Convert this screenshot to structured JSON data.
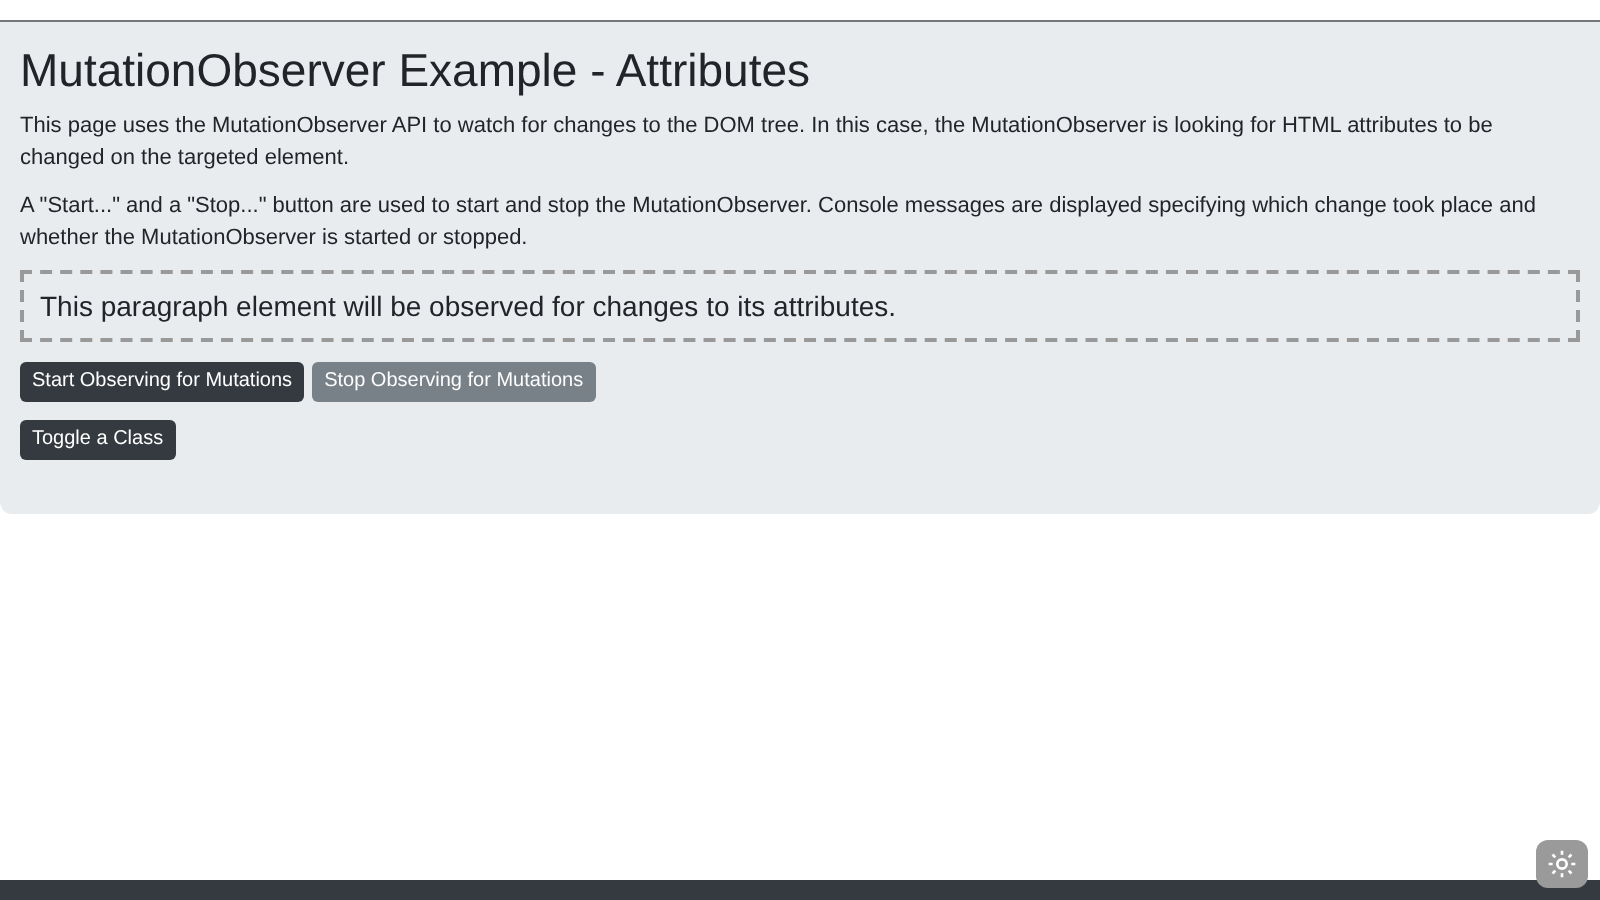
{
  "title": "MutationObserver Example - Attributes",
  "paragraphs": [
    "This page uses the MutationObserver API to watch for changes to the DOM tree. In this case, the MutationObserver is looking for HTML attributes to be changed on the targeted element.",
    "A \"Start...\" and a \"Stop...\" button are used to start and stop the MutationObserver. Console messages are displayed specifying which change took place and whether the MutationObserver is started or stopped."
  ],
  "observed_paragraph": "This paragraph element will be observed for changes to its attributes.",
  "button_rows": [
    [
      {
        "label": "Start Observing for Mutations",
        "disabled": false
      },
      {
        "label": "Stop Observing for Mutations",
        "disabled": true
      }
    ],
    [
      {
        "label": "Toggle a Class",
        "disabled": false
      }
    ]
  ]
}
